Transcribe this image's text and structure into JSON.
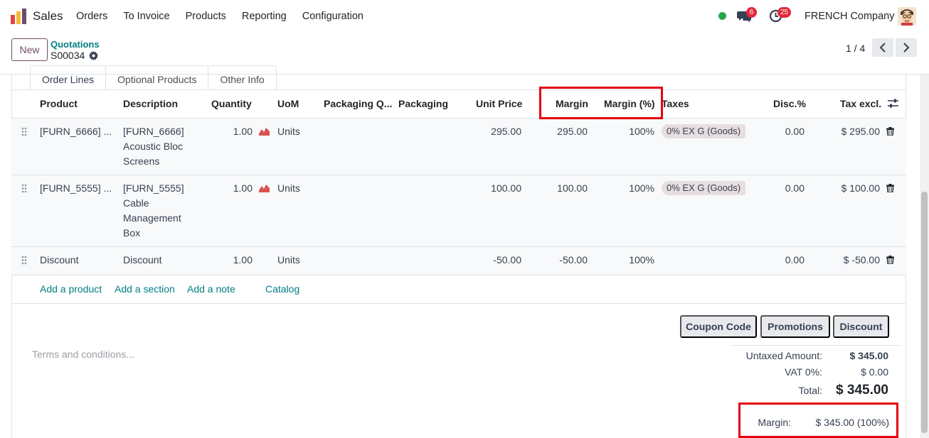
{
  "navbar": {
    "app_name": "Sales",
    "menu": [
      "Orders",
      "To Invoice",
      "Products",
      "Reporting",
      "Configuration"
    ],
    "chat_count": "6",
    "activity_count": "25",
    "company": "FRENCH Company"
  },
  "control_panel": {
    "new_label": "New",
    "breadcrumb": "Quotations",
    "record_name": "S00034",
    "pager": "1 / 4"
  },
  "tabs": [
    "Order Lines",
    "Optional Products",
    "Other Info"
  ],
  "table": {
    "headers": {
      "product": "Product",
      "description": "Description",
      "quantity": "Quantity",
      "uom": "UoM",
      "packaging_qty": "Packaging Q...",
      "packaging": "Packaging",
      "unit_price": "Unit Price",
      "margin": "Margin",
      "margin_pct": "Margin (%)",
      "taxes": "Taxes",
      "disc": "Disc.%",
      "tax_excl": "Tax excl."
    },
    "rows": [
      {
        "product": "[FURN_6666] ...",
        "description": [
          "[FURN_6666]",
          "Acoustic Bloc",
          "Screens"
        ],
        "quantity": "1.00",
        "uom": "Units",
        "unit_price": "295.00",
        "margin": "295.00",
        "margin_pct": "100%",
        "tax": "0% EX G (Goods)",
        "disc": "0.00",
        "subtotal": "$ 295.00"
      },
      {
        "product": "[FURN_5555] ...",
        "description": [
          "[FURN_5555]",
          "Cable",
          "Management",
          "Box"
        ],
        "quantity": "1.00",
        "uom": "Units",
        "unit_price": "100.00",
        "margin": "100.00",
        "margin_pct": "100%",
        "tax": "0% EX G (Goods)",
        "disc": "0.00",
        "subtotal": "$ 100.00"
      },
      {
        "product": "Discount",
        "description": [
          "Discount"
        ],
        "quantity": "1.00",
        "uom": "Units",
        "unit_price": "-50.00",
        "margin": "-50.00",
        "margin_pct": "100%",
        "tax": "",
        "disc": "0.00",
        "subtotal": "$ -50.00"
      }
    ],
    "add_links": [
      "Add a product",
      "Add a section",
      "Add a note",
      "Catalog"
    ]
  },
  "buttons": {
    "coupon": "Coupon Code",
    "promotions": "Promotions",
    "discount": "Discount"
  },
  "terms_placeholder": "Terms and conditions...",
  "totals": {
    "untaxed_label": "Untaxed Amount:",
    "untaxed_value": "$ 345.00",
    "vat_label": "VAT 0%:",
    "vat_value": "$ 0.00",
    "total_label": "Total:",
    "total_value": "$ 345.00",
    "margin_label": "Margin:",
    "margin_value": "$ 345.00 (100%)"
  },
  "colors": {
    "accent": "#714b67",
    "link": "#017e84",
    "highlight": "#e4000f",
    "forecast": "#d9534f"
  }
}
